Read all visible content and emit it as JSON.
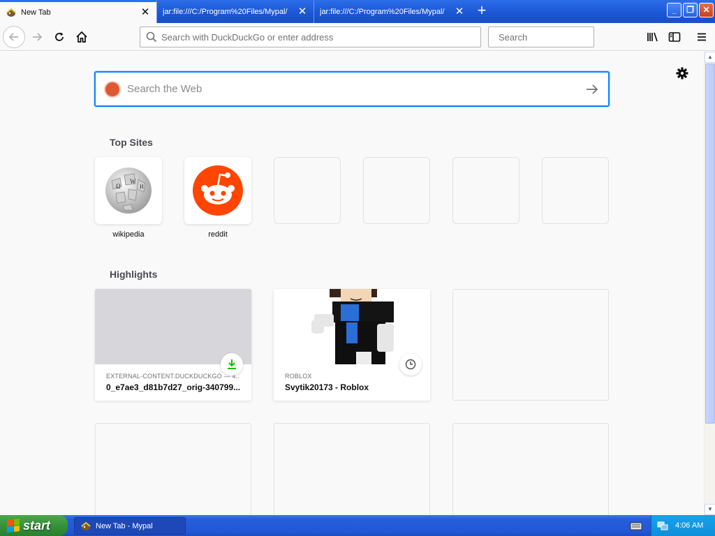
{
  "tabs": [
    {
      "title": "New Tab",
      "active": true
    },
    {
      "title": "jar:file:///C:/Program%20Files/Mypal/",
      "active": false
    },
    {
      "title": "jar:file:///C:/Program%20Files/Mypal/",
      "active": false
    }
  ],
  "toolbar": {
    "url_placeholder": "Search with DuckDuckGo or enter address",
    "search_placeholder": "Search"
  },
  "newtab": {
    "web_search_placeholder": "Search the Web",
    "top_sites_title": "Top Sites",
    "top_sites": [
      {
        "label": "wikipedia",
        "icon": "wikipedia-globe"
      },
      {
        "label": "reddit",
        "icon": "reddit-alien"
      },
      {
        "label": ""
      },
      {
        "label": ""
      },
      {
        "label": ""
      },
      {
        "label": ""
      }
    ],
    "highlights_title": "Highlights",
    "highlights": [
      {
        "host": "EXTERNAL-CONTENT.DUCKDUCKGO — 4...",
        "title": "0_e7ae3_d81b7d27_orig-340799...",
        "badge": "download-icon"
      },
      {
        "host": "ROBLOX",
        "title": "Svytik20173 - Roblox",
        "badge": "clock-icon"
      }
    ]
  },
  "taskbar": {
    "start_label": "start",
    "task_label": "New Tab - Mypal",
    "clock": "4:06 AM"
  },
  "colors": {
    "accent": "#0a84ff",
    "xp_blue": "#245edb",
    "start_green": "#35923a",
    "reddit": "#ff4500",
    "download_green": "#12bc00"
  }
}
